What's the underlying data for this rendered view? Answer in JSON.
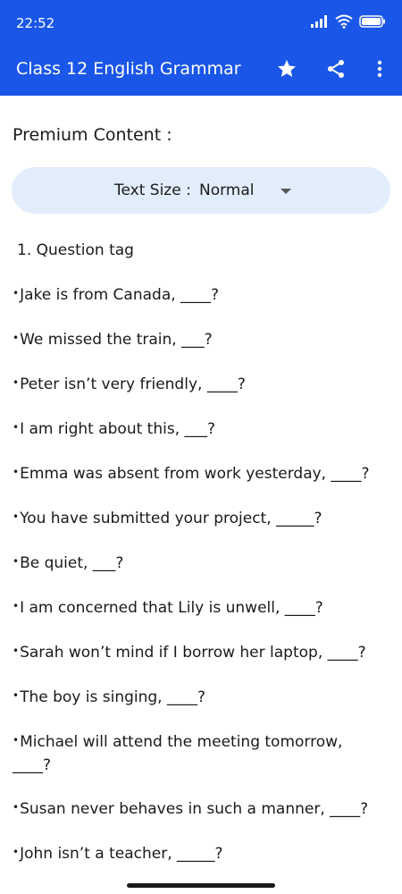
{
  "status": {
    "time": "22:52"
  },
  "toolbar": {
    "title": "Class 12 English Grammar"
  },
  "section": {
    "title": "Premium Content :"
  },
  "text_size": {
    "label": "Text Size :",
    "value": "Normal"
  },
  "question_heading": "1. Question tag",
  "bullet": "•",
  "questions": [
    "Jake is from Canada, ____?",
    "We missed the train, ___?",
    "Peter isn’t very friendly, ____?",
    "I am right about this, ___?",
    "Emma was absent from work yesterday, ____?",
    "You have submitted your project, _____?",
    "Be quiet, ___?",
    "I am concerned that Lily is unwell, ____?",
    "Sarah won’t mind if I borrow her laptop, ____?",
    "The boy is singing, ____?",
    "Michael will attend the meeting tomorrow, ____?",
    "Susan never behaves in such a manner, ____?",
    "John isn’t a teacher, _____?"
  ],
  "colors": {
    "app_bar": "#1a56e8",
    "text_size_bar": "#e2edfc"
  },
  "icons": [
    "signal-icon",
    "wifi-icon",
    "battery-icon",
    "star-icon",
    "share-icon",
    "more-vert-icon",
    "dropdown-caret-icon"
  ]
}
